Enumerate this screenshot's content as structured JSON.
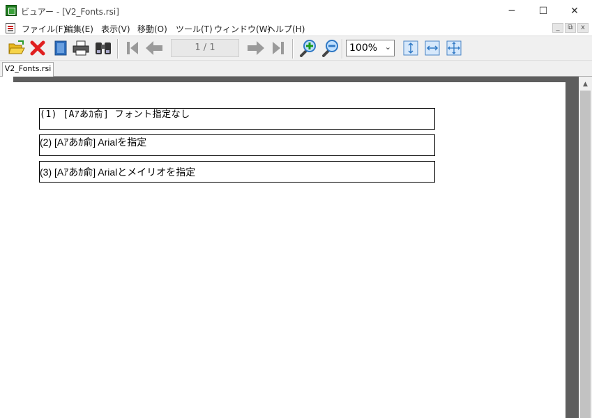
{
  "window": {
    "title": "ビュアー - [V2_Fonts.rsi]",
    "minimize": "─",
    "maximize": "☐",
    "close": "✕"
  },
  "menu": {
    "items": [
      "ファイル(F)",
      "編集(E)",
      "表示(V)",
      "移動(O)",
      "ツール(T)",
      "ウィンドウ(W)",
      "ヘルプ(H)"
    ],
    "mdi_minimize": "_",
    "mdi_restore": "⧉",
    "mdi_close": "x"
  },
  "toolbar": {
    "page_indicator": "1 / 1",
    "zoom": "100%",
    "zoom_options": [
      "100%"
    ],
    "icons": [
      "open-folder-icon",
      "close-x-icon",
      "book-icon",
      "print-icon",
      "binoculars-icon",
      "first-page-icon",
      "previous-page-icon",
      "next-page-icon",
      "last-page-icon",
      "zoom-in-icon",
      "zoom-out-icon",
      "fit-height-icon",
      "fit-width-icon",
      "fit-page-icon"
    ]
  },
  "tabs": [
    "V2_Fonts.rsi"
  ],
  "document": {
    "lines": [
      "(1) [Aｱあｶ俞] フォント指定なし",
      "(2) [Aｱあｶ俞] Arialを指定",
      "(3) [Aｱあｶ俞] Arialとメイリオを指定"
    ]
  },
  "colors": {
    "accent_green": "#1f7a1f",
    "close_red": "#e02020",
    "nav_gray": "#9a9a9a",
    "zoom_blue": "#2f78c4"
  }
}
